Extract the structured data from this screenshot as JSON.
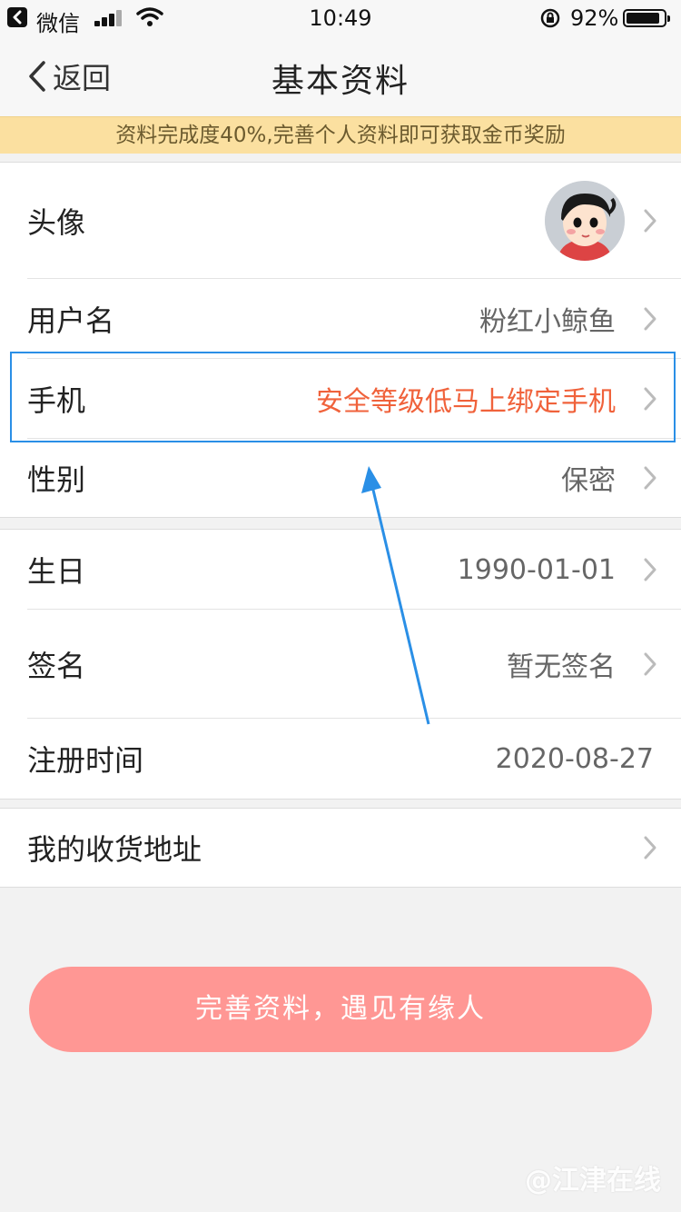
{
  "status_bar": {
    "app_name": "微信",
    "time": "10:49",
    "battery_text": "92%",
    "battery_level": 0.92
  },
  "nav": {
    "back_label": "返回",
    "title": "基本资料"
  },
  "notice": "资料完成度40%,完善个人资料即可获取金币奖励",
  "profile": {
    "rows": [
      {
        "label": "头像",
        "value": ""
      },
      {
        "label": "用户名",
        "value": "粉红小鲸鱼"
      },
      {
        "label": "手机",
        "value": "安全等级低马上绑定手机"
      },
      {
        "label": "性别",
        "value": "保密"
      },
      {
        "label": "生日",
        "value": "1990-01-01"
      },
      {
        "label": "签名",
        "value": "暂无签名"
      },
      {
        "label": "注册时间",
        "value": "2020-08-27"
      },
      {
        "label": "我的收货地址",
        "value": ""
      }
    ]
  },
  "cta_label": "完善资料，遇见有缘人",
  "watermark": "@江津在线",
  "colors": {
    "accent_alert": "#f0623b",
    "cta_bg": "#ff9794",
    "notice_bg": "#fbe0a0",
    "highlight": "#2a8fe6"
  }
}
